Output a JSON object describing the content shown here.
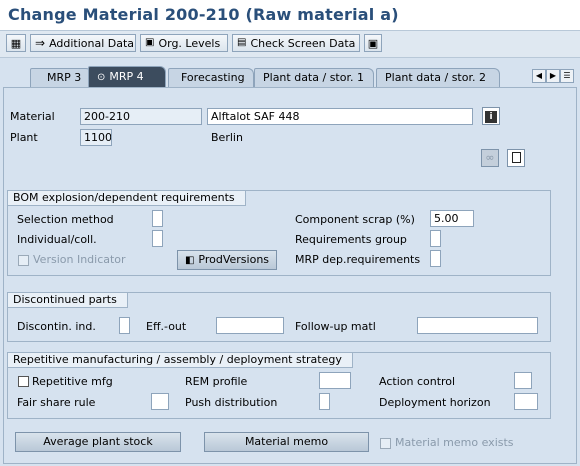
{
  "window": {
    "title": "Change Material 200-210 (Raw material a)"
  },
  "toolbar": {
    "additional_data": "Additional Data",
    "org_levels": "Org. Levels",
    "check_screen_data": "Check Screen Data"
  },
  "tabs": [
    {
      "label": "MRP 3",
      "active": false
    },
    {
      "label": "MRP 4",
      "active": true
    },
    {
      "label": "Forecasting",
      "active": false
    },
    {
      "label": "Plant data / stor. 1",
      "active": false
    },
    {
      "label": "Plant data / stor. 2",
      "active": false
    }
  ],
  "header": {
    "material_label": "Material",
    "material_value": "200-210",
    "material_desc": "Alftalot SAF 448",
    "plant_label": "Plant",
    "plant_value": "1100",
    "plant_name": "Berlin"
  },
  "bom": {
    "title": "BOM explosion/dependent requirements",
    "selection_method": "Selection method",
    "individual_coll": "Individual/coll.",
    "version_indicator": "Version Indicator",
    "prodversions": "ProdVersions",
    "component_scrap": "Component scrap (%)",
    "component_scrap_value": "5.00",
    "requirements_group": "Requirements group",
    "mrp_dep": "MRP dep.requirements"
  },
  "discontinued": {
    "title": "Discontinued parts",
    "discontin_ind": "Discontin. ind.",
    "eff_out": "Eff.-out",
    "follow_up": "Follow-up matl"
  },
  "repetitive": {
    "title": "Repetitive manufacturing / assembly / deployment strategy",
    "repetitive_mfg": "Repetitive mfg",
    "fair_share": "Fair share rule",
    "rem_profile": "REM profile",
    "push_distribution": "Push distribution",
    "action_control": "Action control",
    "deployment_horizon": "Deployment horizon"
  },
  "footer": {
    "average_plant_stock": "Average plant stock",
    "material_memo": "Material memo",
    "material_memo_exists": "Material memo exists"
  }
}
